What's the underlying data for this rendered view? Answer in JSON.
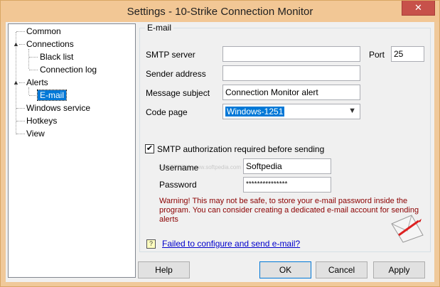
{
  "window": {
    "title": "Settings - 10-Strike Connection Monitor",
    "close_glyph": "✕"
  },
  "tree": {
    "items": [
      {
        "label": "Common"
      },
      {
        "label": "Connections"
      },
      {
        "label": "Black list"
      },
      {
        "label": "Connection log"
      },
      {
        "label": "Alerts"
      },
      {
        "label": "E-mail"
      },
      {
        "label": "Windows service"
      },
      {
        "label": "Hotkeys"
      },
      {
        "label": "View"
      }
    ],
    "expander_glyph": "▲"
  },
  "email": {
    "group_title": "E-mail",
    "smtp_server_label": "SMTP server",
    "smtp_server_value": "",
    "port_label": "Port",
    "port_value": "25",
    "sender_label": "Sender address",
    "sender_value": "",
    "subject_label": "Message subject",
    "subject_value": "Connection Monitor alert",
    "codepage_label": "Code page",
    "codepage_value": "Windows-1251",
    "auth_label": "SMTP authorization required before sending",
    "auth_checked": "✔",
    "username_label": "Username",
    "username_value": "Softpedia",
    "password_label": "Password",
    "password_value": "***************",
    "warning": "Warning! This may not be safe, to store your e-mail password inside the program. You can consider creating a dedicated e-mail account for sending alerts",
    "help_link": "Failed to configure and send e-mail?",
    "help_icon_glyph": "?"
  },
  "buttons": {
    "help": "Help",
    "ok": "OK",
    "cancel": "Cancel",
    "apply": "Apply"
  },
  "watermark": "SOFTPEDIA www.softpedia.com",
  "colors": {
    "selection": "#0078d7",
    "warning": "#8b0000",
    "link": "#0000cc",
    "title_bar": "#f2c795"
  }
}
